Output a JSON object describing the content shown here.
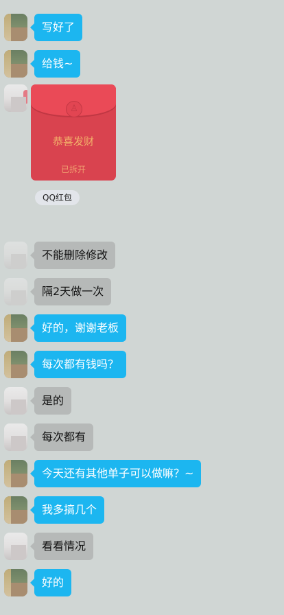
{
  "messages": [
    {
      "text": "写好了"
    },
    {
      "text": "给钱~"
    },
    {
      "text": "不能删除修改"
    },
    {
      "text": "隔2天做一次"
    },
    {
      "text": "好的，谢谢老板"
    },
    {
      "text": "每次都有钱吗？"
    },
    {
      "text": "是的"
    },
    {
      "text": "每次都有"
    },
    {
      "text": "今天还有其他单子可以做嘛？~"
    },
    {
      "text": "我多搞几个"
    },
    {
      "text": "看看情况"
    },
    {
      "text": "好的"
    }
  ],
  "red_packet": {
    "greeting": "恭喜发财",
    "status": "已拆开",
    "source_label": "QQ红包",
    "icon": "qq-penguin-icon"
  },
  "colors": {
    "background": "#d0d6d4",
    "sent_bubble": "#1cb6f0",
    "received_bubble": "#b6b9b8",
    "red_packet": "#d9434f"
  }
}
